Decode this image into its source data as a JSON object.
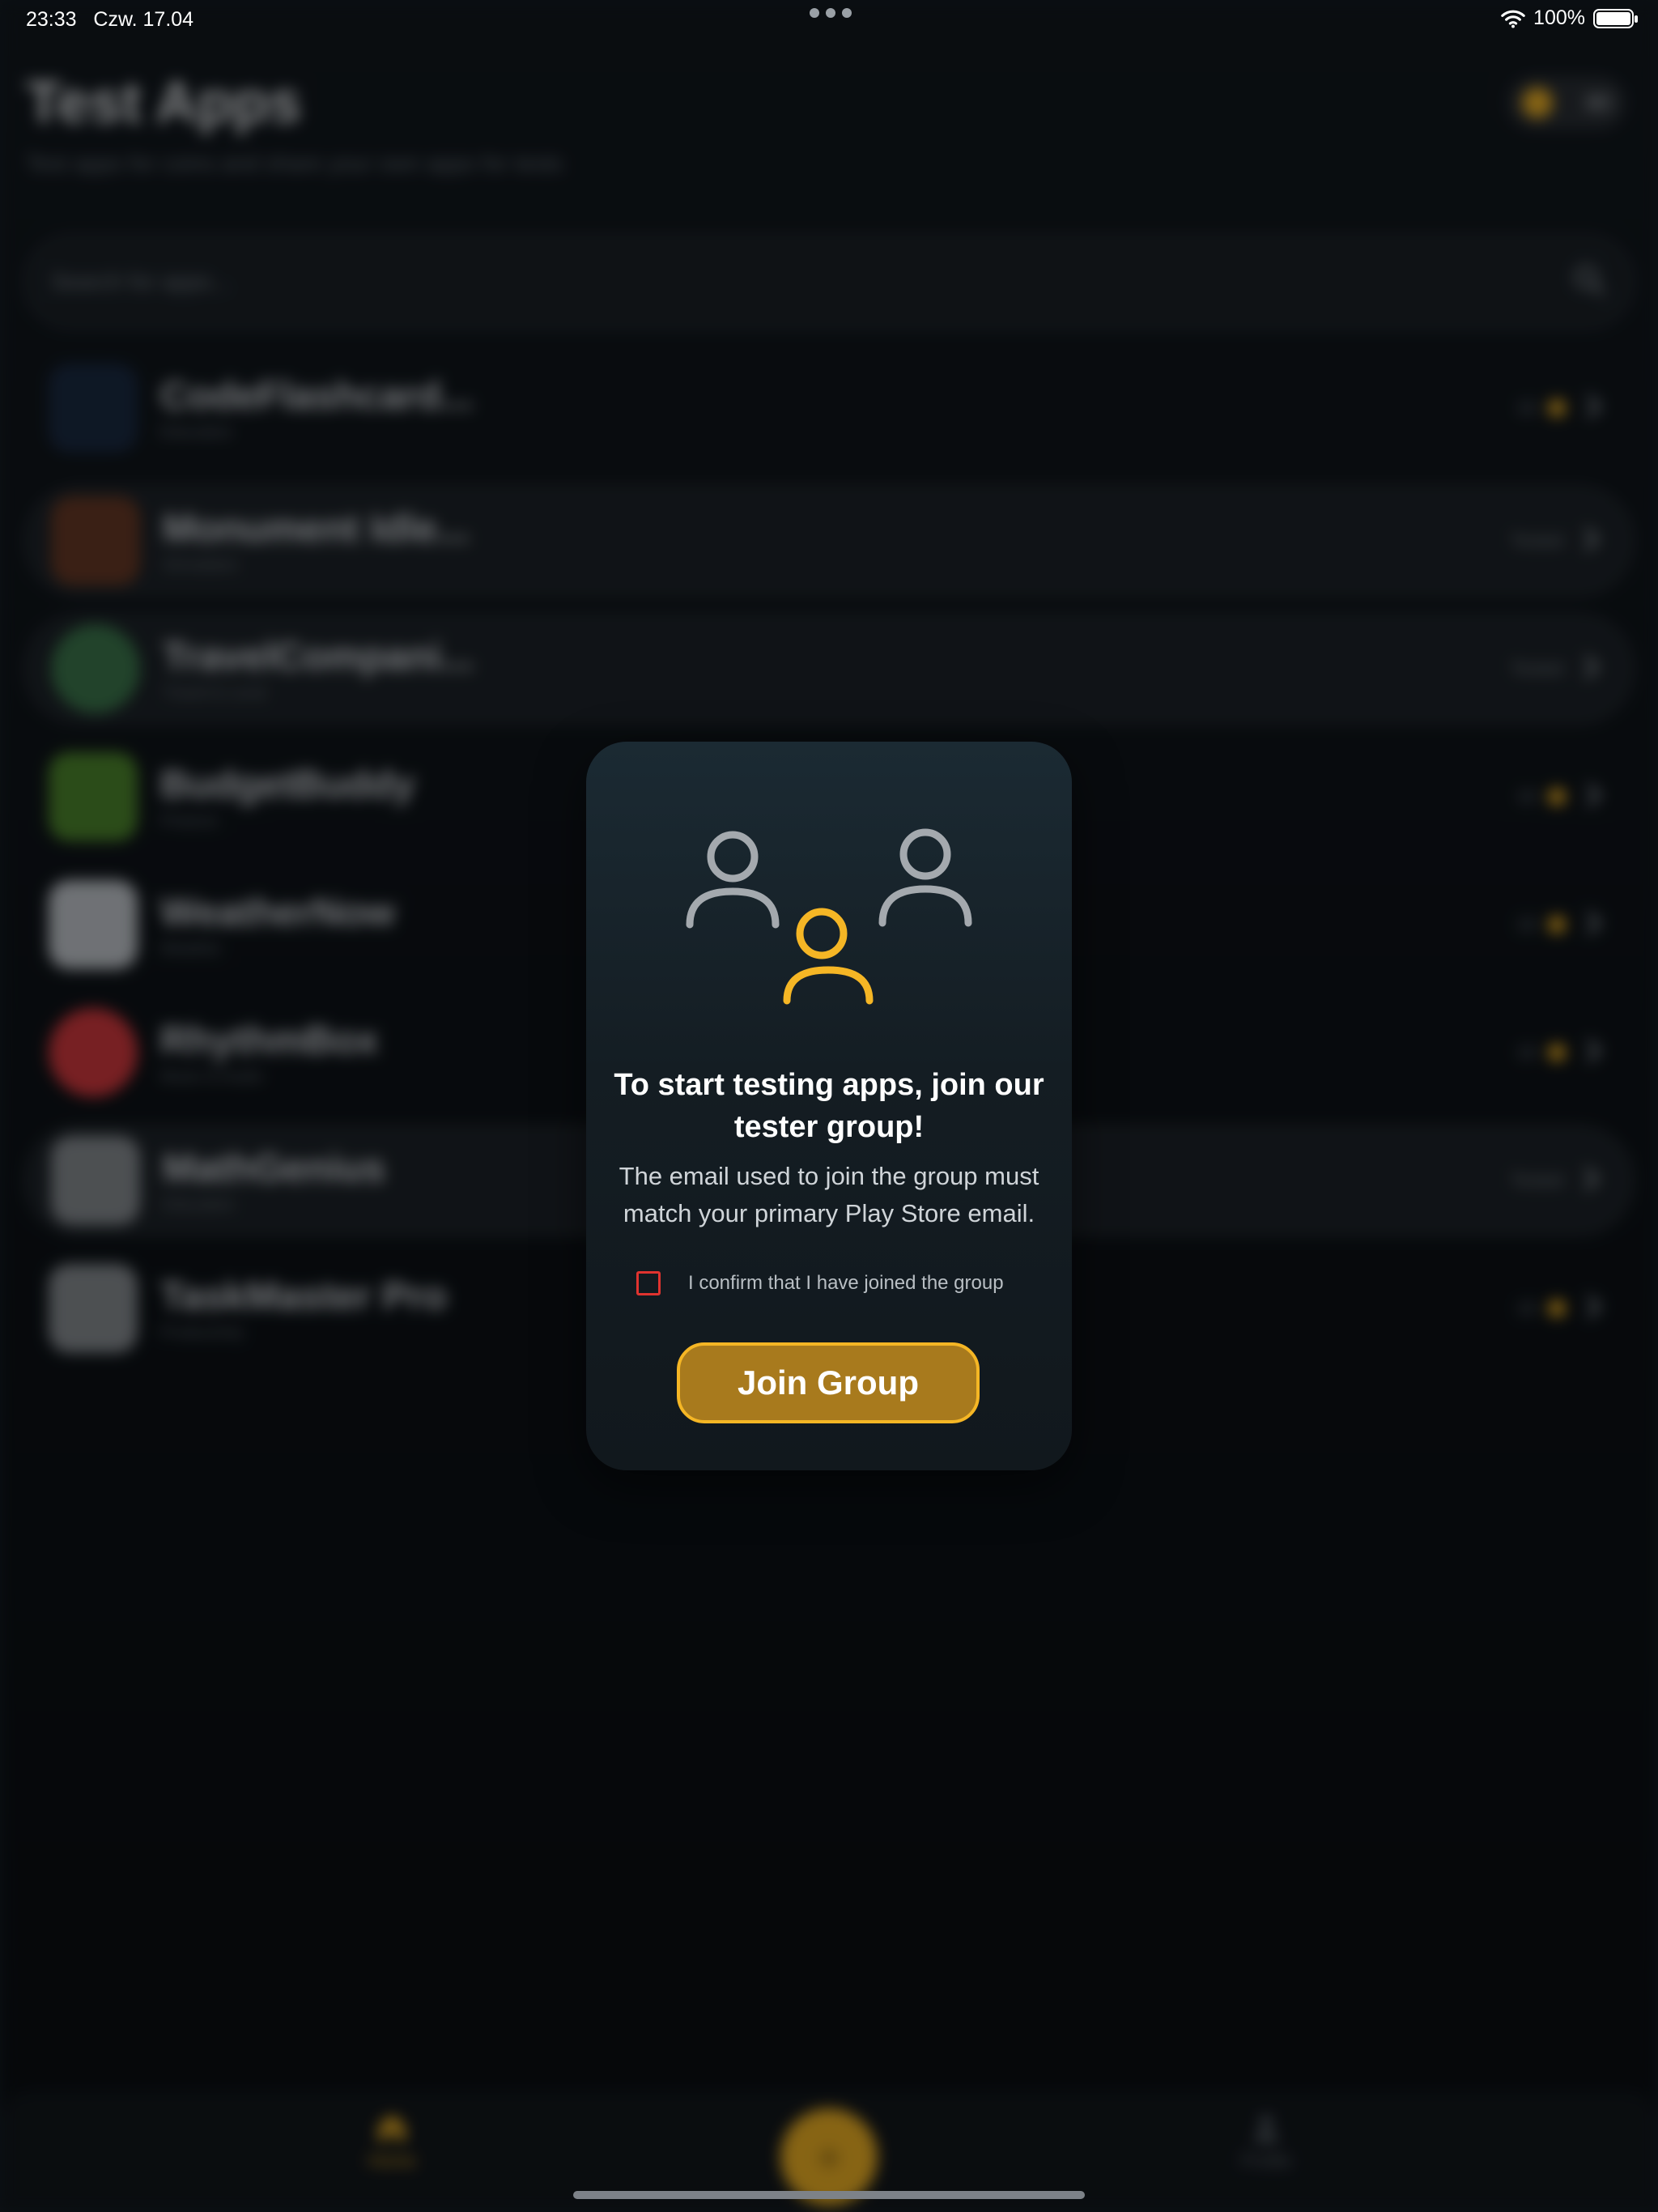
{
  "status_bar": {
    "time": "23:33",
    "date": "Czw. 17.04",
    "battery": "100%"
  },
  "header": {
    "title": "Test Apps",
    "subtitle": "Test apps for coins and share your own apps for tests",
    "coins": "80"
  },
  "search": {
    "placeholder": "Search for apps..."
  },
  "apps": [
    {
      "name": "CodeFlashcard...",
      "meta": "Education",
      "right": "10",
      "highlighted": false
    },
    {
      "name": "Monument Idle...",
      "meta": "Simulation",
      "right": "Tested",
      "highlighted": true
    },
    {
      "name": "TravelCompani...",
      "meta": "Travel & Local",
      "right": "Tested",
      "highlighted": true
    },
    {
      "name": "BudgetBuddy",
      "meta": "Finance",
      "right": "10",
      "highlighted": false
    },
    {
      "name": "WeatherNow",
      "meta": "Weather",
      "right": "10",
      "highlighted": false
    },
    {
      "name": "RhythmBox",
      "meta": "Music & Audio",
      "right": "10",
      "highlighted": false
    },
    {
      "name": "MathGenius",
      "meta": "Education",
      "right": "Tested",
      "highlighted": true
    },
    {
      "name": "TaskMaster Pro",
      "meta": "Productivity",
      "right": "10",
      "highlighted": false
    }
  ],
  "tabs": {
    "home": "Home",
    "profile": "Profile",
    "add": "+"
  },
  "modal": {
    "title": "To start testing apps, join our tester group!",
    "body": "The email used to join the group must match your primary Play Store email.",
    "confirm_label": "I confirm that I have joined the group",
    "confirm_checked": false,
    "button_label": "Join Group"
  },
  "colors": {
    "accent": "#f5b625",
    "button_bg": "#a87a1d",
    "checkbox_border": "#e0332f",
    "background": "#0b1014"
  }
}
